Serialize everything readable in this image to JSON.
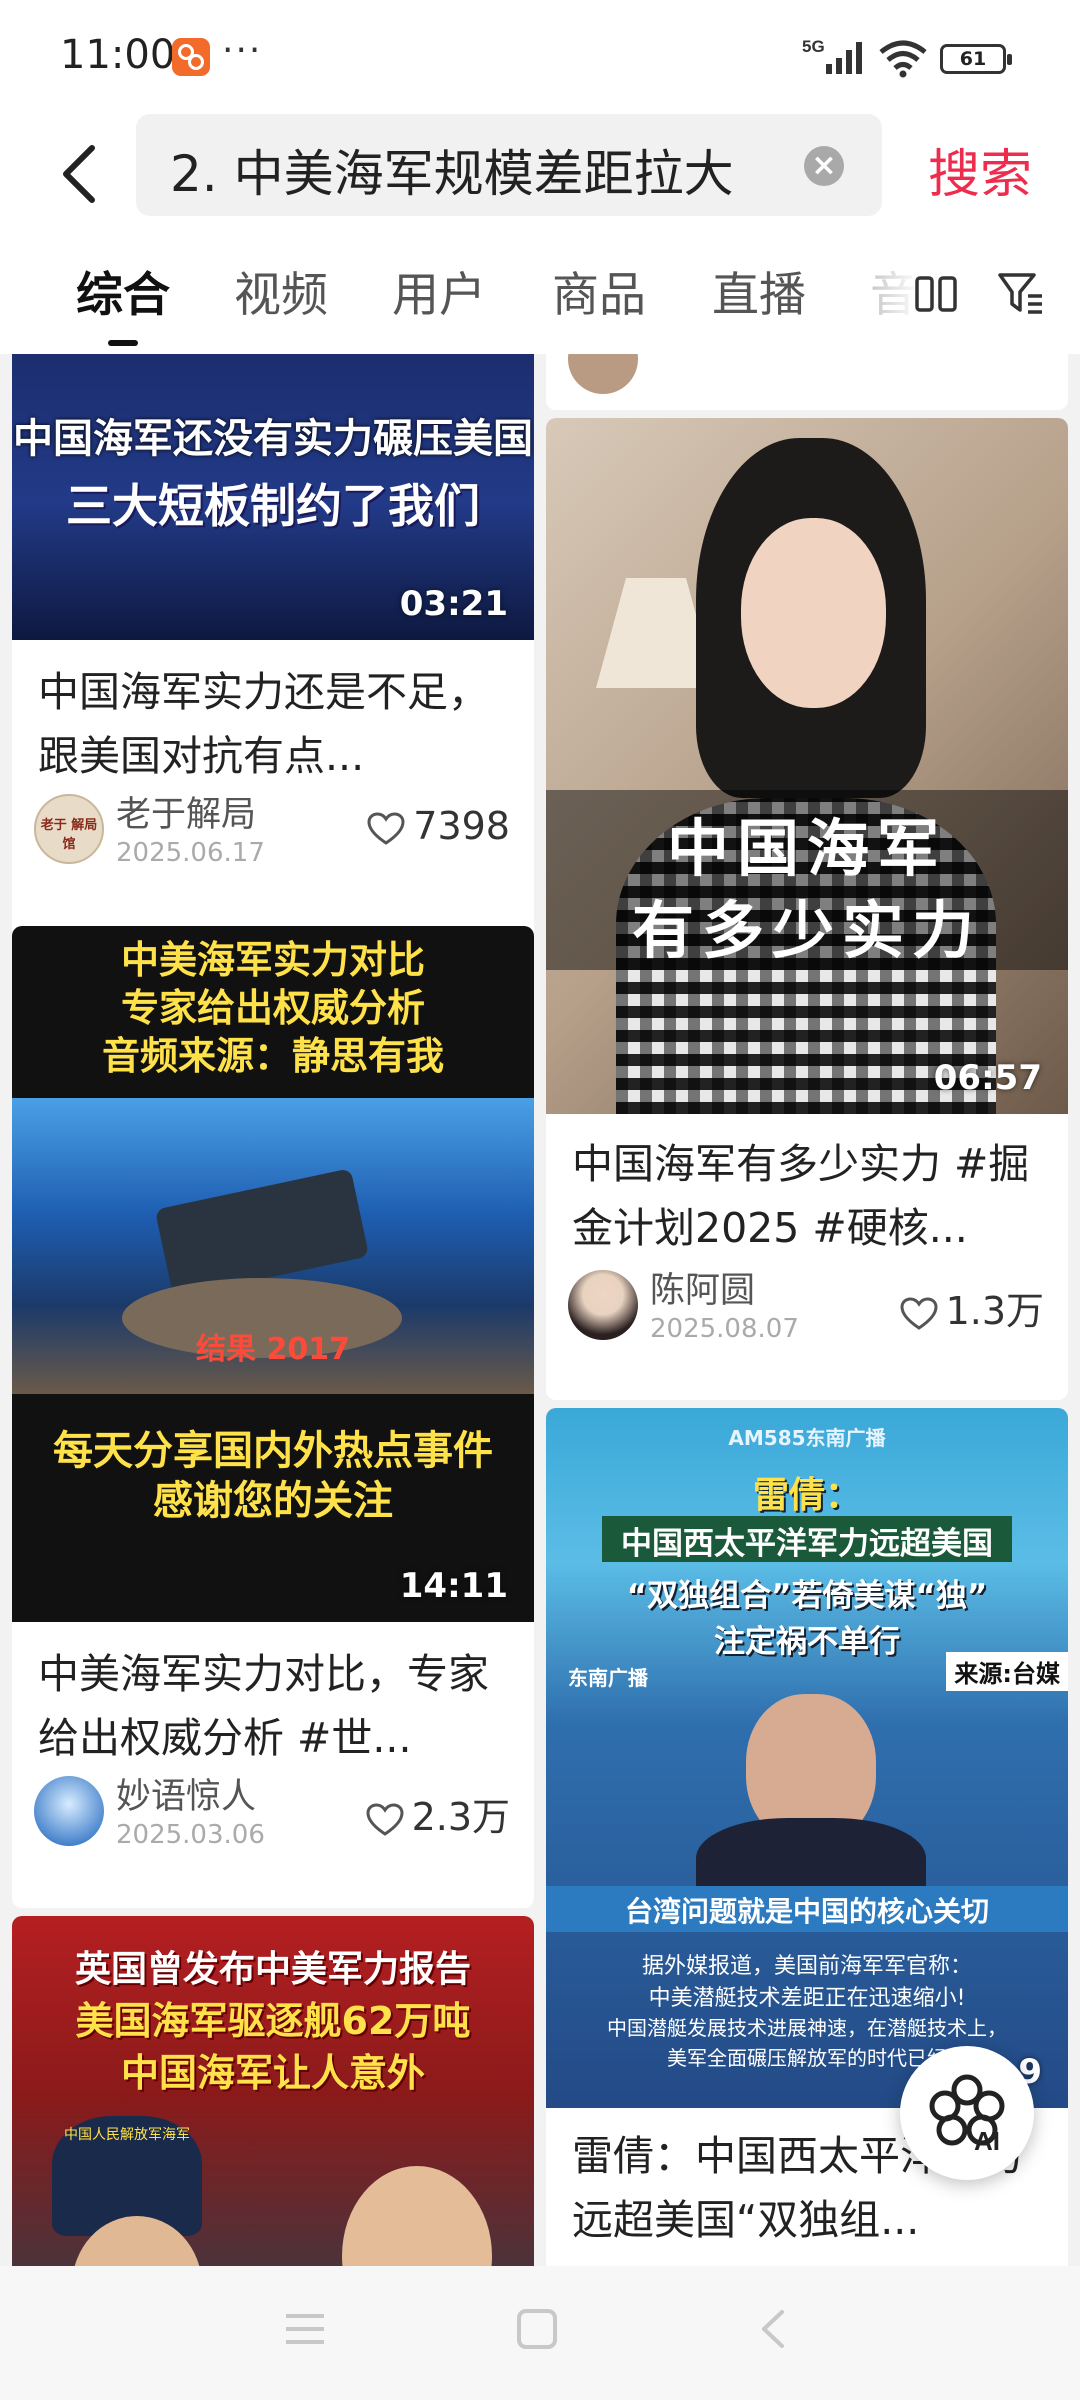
{
  "status": {
    "time": "11:00",
    "more": "···",
    "network": "5G",
    "battery": "61"
  },
  "search": {
    "query": "2. 中美海军规模差距拉大",
    "button": "搜索"
  },
  "tabs": [
    "综合",
    "视频",
    "用户",
    "商品",
    "直播",
    "音"
  ],
  "cards": [
    {
      "thumb_lines": [
        "中国海军还没有实力碾压美国",
        "三大短板制约了我们"
      ],
      "duration": "03:21",
      "title": "中国海军实力还是不足，跟美国对抗有点...",
      "author": "老于解局",
      "avatar_text": "老于 解局馆",
      "date": "2025.06.17",
      "likes": "7398"
    },
    {
      "thumb_top": [
        "中美海军实力对比",
        "专家给出权威分析",
        "音频来源：静思有我"
      ],
      "thumb_mid": "结果 2017",
      "thumb_bottom": [
        "每天分享国内外热点事件",
        "感谢您的关注"
      ],
      "duration": "14:11",
      "title": "中美海军实力对比，专家给出权威分析 #世...",
      "author": "妙语惊人",
      "date": "2025.03.06",
      "likes": "2.3万"
    },
    {
      "thumb_lines": [
        "英国曾发布中美军力报告",
        "美国海军驱逐舰62万吨",
        "中国海军让人意外"
      ],
      "badge": "中国人民解放军海军"
    },
    {
      "thumb_lines": [
        "中国海军",
        "有多少实力"
      ],
      "duration": "06:57",
      "title": "中国海军有多少实力 #掘金计划2025 #硬核...",
      "author": "陈阿圆",
      "date": "2025.08.07",
      "likes": "1.3万"
    },
    {
      "thumb_station": "AM585东南广播",
      "thumb_head": "雷倩：",
      "thumb_lines": [
        "中国西太平洋军力远超美国",
        "“双独组合”若倚美谋“独”",
        "注定祸不单行"
      ],
      "source": "来源:台媒",
      "channel": "东南广播",
      "caption": "台湾问题就是中国的核心关切",
      "sub_lines": [
        "据外媒报道，美国前海军军官称：",
        "中美潜艇技术差距正在迅速缩小!",
        "中国潜艇发展技术进展神速，在潜艇技术上，",
        "美军全面碾压解放军的时代已经"
      ],
      "duration": "9",
      "title": "雷倩：中国西太平洋军力远超美国“双独组..."
    }
  ],
  "fab": {
    "label": "AI"
  },
  "colors": {
    "accent": "#ee2c4d",
    "overlay_yellow": "#ffe24a"
  }
}
